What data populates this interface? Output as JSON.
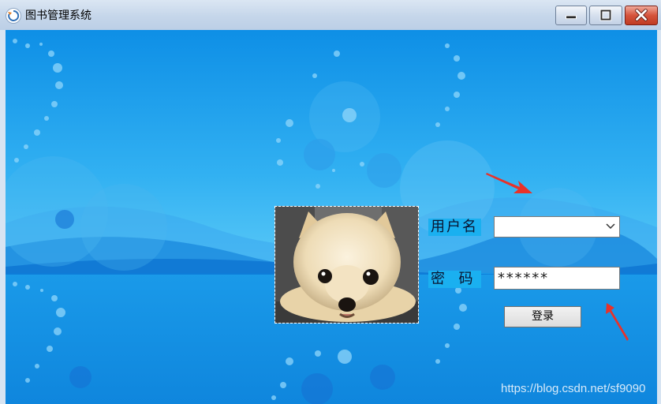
{
  "window": {
    "title": "图书管理系统",
    "icon": "app-refresh-icon"
  },
  "titlebar_buttons": {
    "minimize": "minimize-icon",
    "maximize": "maximize-icon",
    "close": "close-icon"
  },
  "login": {
    "username_label": "用户名",
    "username_value": "",
    "password_label": "密  码",
    "password_value": "******",
    "login_button": "登录"
  },
  "watermark": "https://blog.csdn.net/sf9090",
  "colors": {
    "background": "#1b9be9",
    "label_bg": "#1ab0f0",
    "arrow": "#e8322a",
    "close_button": "#c7432b"
  }
}
